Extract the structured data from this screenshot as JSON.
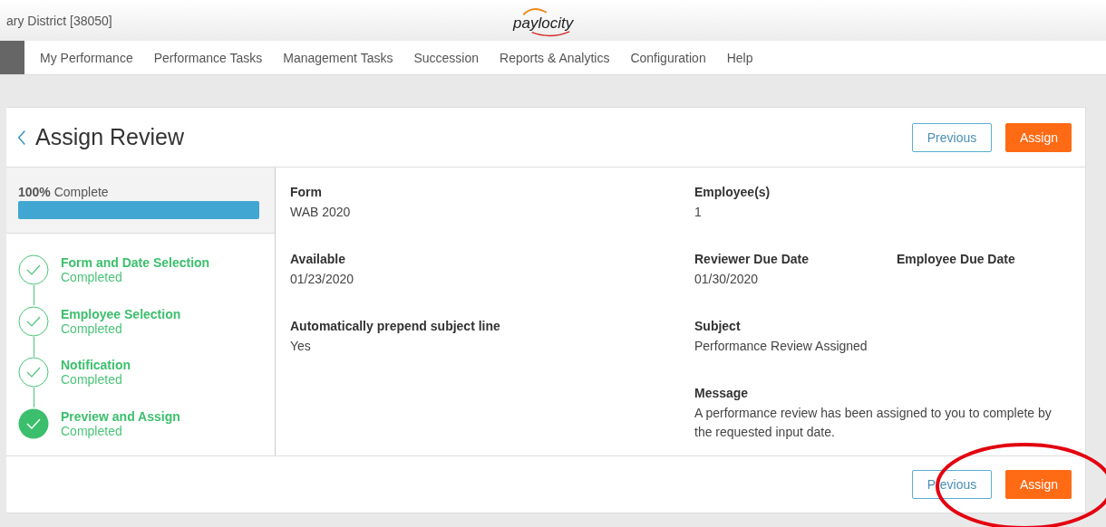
{
  "header": {
    "org_name": "ary District [38050]",
    "logo": "paylocity"
  },
  "nav": [
    {
      "label": "My Performance"
    },
    {
      "label": "Performance Tasks"
    },
    {
      "label": "Management Tasks"
    },
    {
      "label": "Succession"
    },
    {
      "label": "Reports & Analytics"
    },
    {
      "label": "Configuration"
    },
    {
      "label": "Help"
    }
  ],
  "page": {
    "title": "Assign Review",
    "top_buttons": [
      {
        "label": "Previous",
        "kind": "secondary"
      },
      {
        "label": "Assign",
        "kind": "primary"
      }
    ]
  },
  "progress": {
    "percent": "100%",
    "label": "Complete",
    "level": 1
  },
  "steps": [
    {
      "title": "Form and Date Selection",
      "status": "Completed",
      "selected": false
    },
    {
      "title": "Employee Selection",
      "status": "Completed",
      "selected": false
    },
    {
      "title": "Notification",
      "status": "Completed",
      "selected": false
    },
    {
      "title": "Preview and Assign",
      "status": "Completed",
      "selected": true
    }
  ],
  "details": [
    {
      "left": {
        "label": "Form",
        "value": "WAB 2020"
      },
      "right": [
        {
          "label": "Employee(s)",
          "value": "1"
        }
      ]
    },
    {
      "left": {
        "label": "Available",
        "value": "01/23/2020"
      },
      "right": [
        {
          "label": "Reviewer Due Date",
          "value": "01/30/2020"
        },
        {
          "label": "Employee Due Date"
        }
      ]
    },
    {
      "left": {
        "label": "Automatically prepend subject line",
        "value": "Yes"
      },
      "right": [
        {
          "label": "Subject",
          "value": "Performance Review Assigned"
        }
      ]
    },
    {
      "right": [
        {
          "label": "Message",
          "value": "A performance review has been assigned to you to complete by the requested input date."
        }
      ]
    }
  ],
  "bottom_buttons": [
    {
      "label": "Previous",
      "kind": "secondary"
    },
    {
      "label": "Assign",
      "kind": "primary"
    }
  ],
  "annotations": [
    {
      "kind": "ellipse"
    }
  ]
}
